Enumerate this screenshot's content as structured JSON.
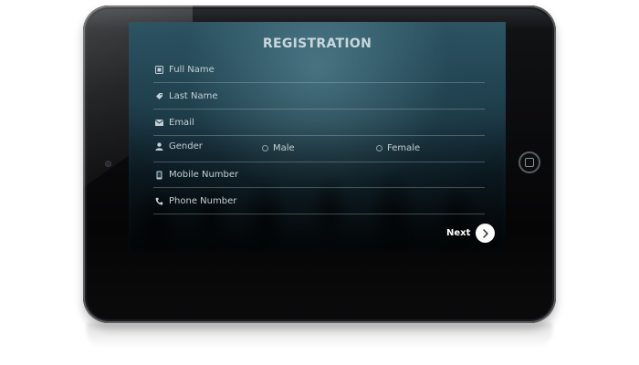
{
  "form": {
    "title": "REGISTRATION",
    "fields": [
      {
        "label": "Full Name",
        "icon": "id-card-icon"
      },
      {
        "label": "Last Name",
        "icon": "tag-icon"
      },
      {
        "label": "Email",
        "icon": "envelope-icon"
      },
      {
        "label": "Mobile Number",
        "icon": "mobile-phone-icon"
      },
      {
        "label": "Phone Number",
        "icon": "phone-handset-icon"
      }
    ],
    "gender": {
      "label": "Gender",
      "icon": "user-icon",
      "options": [
        "Male",
        "Female"
      ]
    },
    "next_label": "Next",
    "next_icon": "chevron-right-icon"
  },
  "device": {
    "side_arrow": "»"
  },
  "colors": {
    "screen_accent": "#2c5564",
    "text": "#c4d0d5",
    "button": "#ffffff"
  }
}
